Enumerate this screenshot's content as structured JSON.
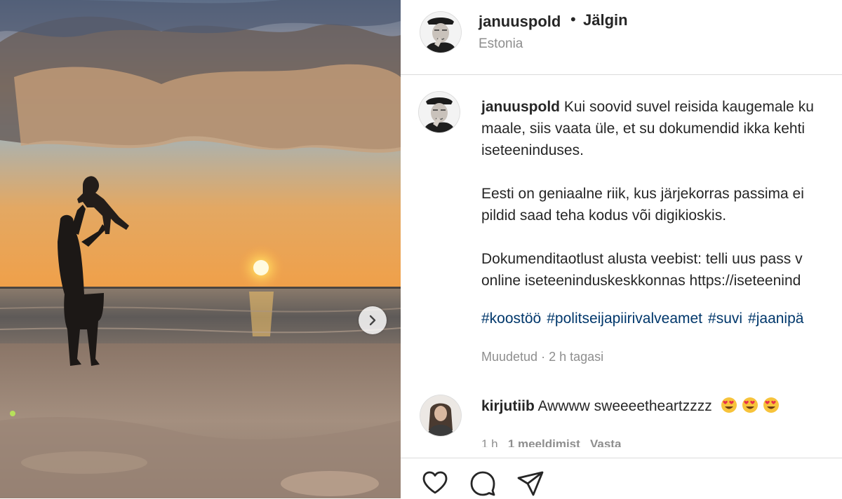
{
  "post": {
    "username": "januuspold",
    "separator": "•",
    "follow_label": "Jälgin",
    "location": "Estonia"
  },
  "caption": {
    "username": "januuspold",
    "lines": [
      "Kui soovid suvel reisida kaugemale ku",
      "maale, siis vaata üle, et su dokumendid ikka kehti",
      "iseteeninduses.",
      "",
      "Eesti on geniaalne riik, kus järjekorras passima ei",
      "pildid saad teha kodus või digikioskis.",
      "",
      "Dokumenditaotlust alusta veebist: telli uus pass v",
      "online iseteeninduskeskkonnas https://iseteenind"
    ],
    "hashtags": [
      "#koostöö",
      "#politseijapiirivalveamet",
      "#suvi",
      "#jaanipä"
    ],
    "edited": "Muudetud",
    "meta_separator": "·",
    "time": "2 h tagasi"
  },
  "comment": {
    "username": "kirjutiib",
    "text": "Awwww sweeeetheartzzzz",
    "emoji_icon": "smiling-face-with-heart-eyes",
    "emoji_count": 3,
    "time": "1 h",
    "likes": "1 meeldimist",
    "reply": "Vasta"
  },
  "icons": {
    "like": "heart-icon",
    "comment": "comment-bubble-icon",
    "share": "paper-plane-icon",
    "next": "chevron-right-icon"
  },
  "colors": {
    "text": "#262626",
    "muted": "#8e8e8e",
    "hashtag": "#00376b",
    "divider": "#dbdbdb"
  }
}
